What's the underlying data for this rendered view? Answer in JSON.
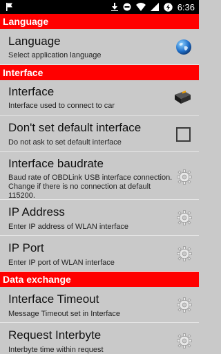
{
  "status_bar": {
    "left_icon": "flag-icon",
    "time": "6:36",
    "icons": [
      "download-arrow-icon",
      "do-not-disturb-icon",
      "wifi-icon",
      "signal-icon",
      "battery-charging-icon"
    ]
  },
  "colors": {
    "accent": "#ff0000",
    "background": "#c9c9c9",
    "divider": "#e6e6e6"
  },
  "sections": [
    {
      "header": "Language",
      "items": [
        {
          "title": "Language",
          "summary": "Select application language",
          "icon": "globe-icon"
        }
      ]
    },
    {
      "header": "Interface",
      "items": [
        {
          "title": "Interface",
          "summary": "Interface used to connect to car",
          "icon": "obd-adapter-icon"
        },
        {
          "title": "Don't set default interface",
          "summary": "Do not ask to set default interface",
          "icon": "checkbox-unchecked-icon",
          "checked": false
        },
        {
          "title": "Interface baudrate",
          "summary": "Baud rate of OBDLink USB interface connection. Change if there is no connection at default 115200.",
          "icon": "gear-icon"
        },
        {
          "title": "IP Address",
          "summary": "Enter IP address of WLAN interface",
          "icon": "gear-icon"
        },
        {
          "title": "IP Port",
          "summary": "Enter IP port of WLAN interface",
          "icon": "gear-icon"
        }
      ]
    },
    {
      "header": "Data exchange",
      "items": [
        {
          "title": "Interface Timeout",
          "summary": "Message Timeout set in Interface",
          "icon": "gear-icon"
        },
        {
          "title": "Request Interbyte",
          "summary": "Interbyte time within request",
          "icon": "gear-icon"
        }
      ]
    }
  ]
}
